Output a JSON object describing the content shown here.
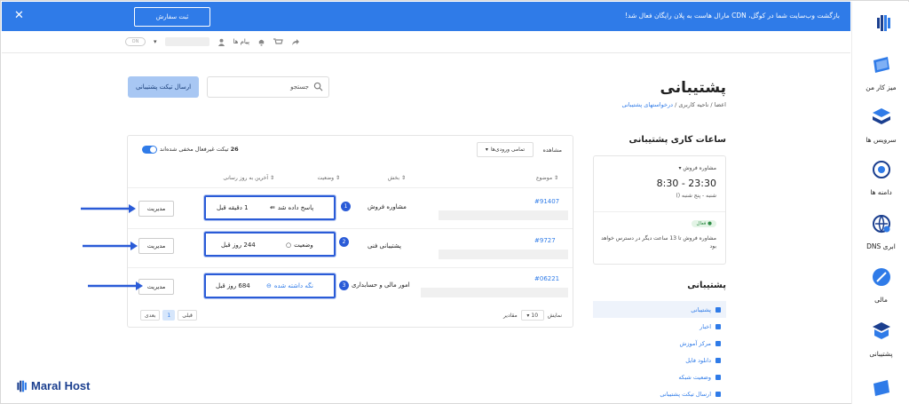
{
  "banner": {
    "close_icon": "close-icon",
    "order_button": "ثبت سفارش",
    "message": "بازگشت وب‌سایت شما در کوگل، CDN مارال هاست به پلان رایگان فعال شد!"
  },
  "toolbar": {
    "toggle_text": "ON",
    "messages_label": "پیام ها"
  },
  "nav": {
    "items": [
      {
        "label": "میز کار من",
        "icon": "dashboard-icon"
      },
      {
        "label": "سرویس ها",
        "icon": "services-icon"
      },
      {
        "label": "دامنه ها",
        "icon": "domains-icon"
      },
      {
        "label": "DNS ابری",
        "icon": "cloud-dns-icon"
      },
      {
        "label": "مالی",
        "icon": "finance-icon"
      },
      {
        "label": "پشتیبانی",
        "icon": "support-icon"
      }
    ]
  },
  "page": {
    "title": "پشتیبانی",
    "breadcrumb": [
      "اعضا",
      "ناحیه کاربری",
      "درخواستهای پشتیبانی"
    ],
    "search_placeholder": "جستجو",
    "send_ticket": "ارسال تیکت پشتیبانی"
  },
  "hours": {
    "title": "ساعات کاری پشتیبانی",
    "department": "مشاوره فروش",
    "time": "8:30 - 23:30",
    "days": "شنبه - پنج شنبه ()",
    "badge": "فعال",
    "note": "مشاوره فروش تا 13 ساعت دیگر در دسترس خواهد بود"
  },
  "support_menu": {
    "title": "پشتیبانی",
    "items": [
      "پشتیبانی",
      "اخبار",
      "مرکز آموزش",
      "دانلود فایل",
      "وضعیت شبکه",
      "ارسال تیکت پشتیبانی"
    ]
  },
  "tickets": {
    "filter_label": "مشاهده",
    "filter_value": "تمامی ورودی‌ها",
    "hidden_count": "26",
    "hidden_label": "تیکت غیرفعال مخفی شده‌اند",
    "headers": {
      "subject": "موضوع",
      "department": "بخش",
      "status": "وضعیت",
      "last_update": "آخرین به روز رسانی"
    },
    "rows": [
      {
        "id": "#91407",
        "department": "مشاوره فروش",
        "status": "پاسخ داده شد",
        "last_update": "1 دقیقه قبل",
        "badge": "1",
        "manage": "مدیریت"
      },
      {
        "id": "#9727",
        "department": "پشتیبانی فنی",
        "status": "وضعیت",
        "last_update": "244 روز قبل",
        "badge": "2",
        "manage": "مدیریت"
      },
      {
        "id": "#06221",
        "department": "امور مالی و حسابداری",
        "status": "نگه داشته شده",
        "last_update": "684 روز قبل",
        "badge": "3",
        "manage": "مدیریت"
      }
    ],
    "footer": {
      "show_label": "نمایش",
      "per_page": "10",
      "items_label": "مقادیر",
      "prev": "قبلی",
      "page": "1",
      "next": "بعدی"
    }
  },
  "brand": {
    "logo_text": "Maral Host"
  },
  "colors": {
    "primary": "#2f7be8",
    "highlight": "#2a5bd7"
  }
}
